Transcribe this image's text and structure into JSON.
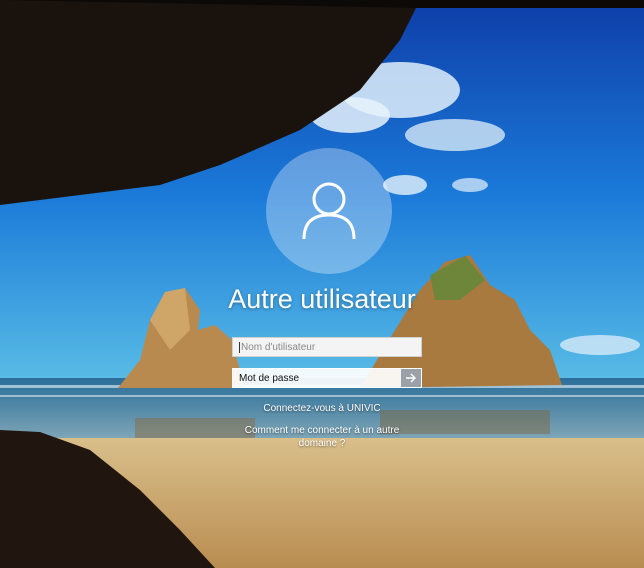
{
  "login": {
    "username": "Autre utilisateur",
    "username_placeholder": "Nom d'utilisateur",
    "password_placeholder": "Mot de passe",
    "sign_in_to": "Connectez-vous à UNIVIC",
    "other_domain_line1": "Comment me connecter à un autre",
    "other_domain_line2": "domaine ?"
  },
  "icons": {
    "avatar": "user-icon",
    "submit": "arrow-right-icon"
  },
  "colors": {
    "sky": "#1f78d8",
    "sea": "#2f6f96",
    "sand": "#c7a56c",
    "rock": "#b98a4f"
  }
}
